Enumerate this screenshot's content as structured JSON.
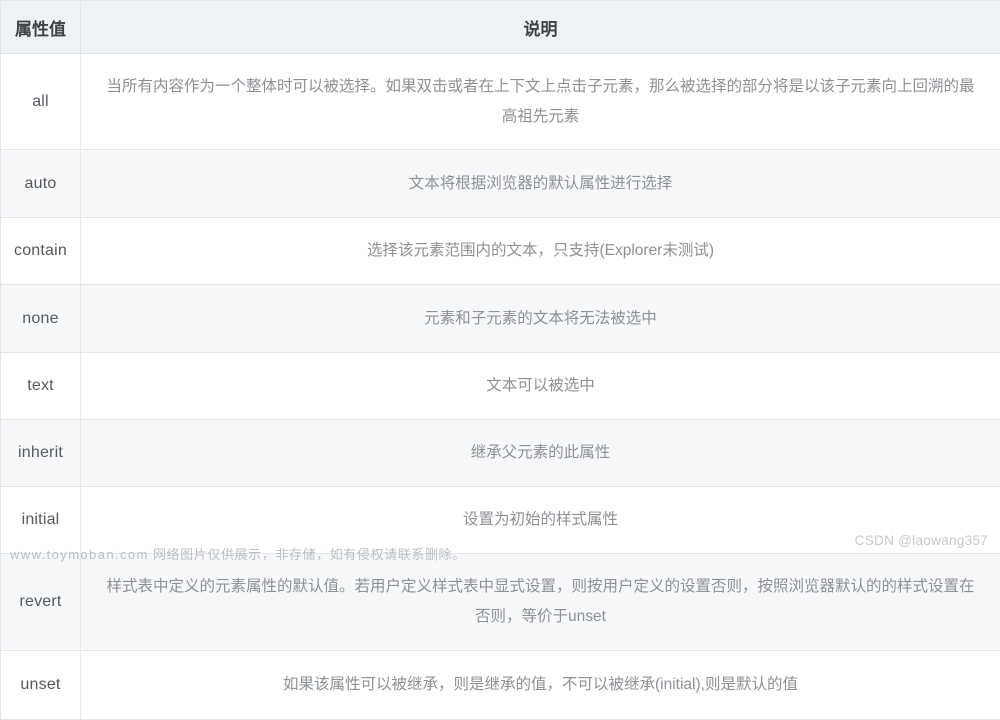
{
  "table": {
    "headers": {
      "value": "属性值",
      "description": "说明"
    },
    "rows": [
      {
        "value": "all",
        "description": "当所有内容作为一个整体时可以被选择。如果双击或者在上下文上点击子元素，那么被选择的部分将是以该子元素向上回溯的最高祖先元素"
      },
      {
        "value": "auto",
        "description": "文本将根据浏览器的默认属性进行选择"
      },
      {
        "value": "contain",
        "description": "选择该元素范围内的文本，只支持(Explorer未测试)"
      },
      {
        "value": "none",
        "description": "元素和子元素的文本将无法被选中"
      },
      {
        "value": "text",
        "description": "文本可以被选中"
      },
      {
        "value": "inherit",
        "description": "继承父元素的此属性"
      },
      {
        "value": "initial",
        "description": "设置为初始的样式属性"
      },
      {
        "value": "revert",
        "description": "样式表中定义的元素属性的默认值。若用户定义样式表中显式设置，则按用户定义的设置否则，按照浏览器默认的的样式设置在否则，等价于unset"
      },
      {
        "value": "unset",
        "description": "如果该属性可以被继承，则是继承的值，不可以被继承(initial),则是默认的值"
      }
    ]
  },
  "watermarks": {
    "csdn": "CSDN @laowang357",
    "footer_site": "www.toymoban.com",
    "footer_note": "网络图片仅供展示，非存储，如有侵权请联系删除。"
  },
  "colors": {
    "header_background": "#eef1f5",
    "row_alt_background": "#f7f8f9",
    "row_background": "#ffffff",
    "border": "#e3e5e8",
    "value_text": "#55595e",
    "description_text": "#8d9095",
    "watermark_text": "#c6c8cb"
  }
}
